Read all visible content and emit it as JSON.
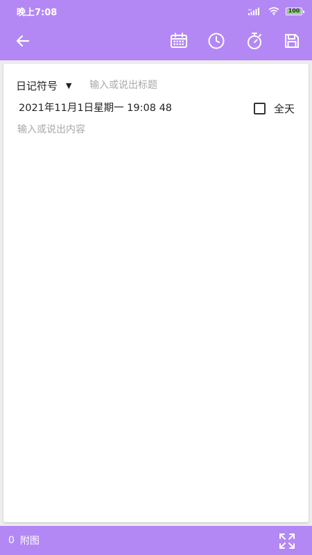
{
  "status_bar": {
    "time": "晚上7:08",
    "battery": "100",
    "battery_color": "#8ee07a"
  },
  "theme": {
    "accent": "#b388f5",
    "background": "#ededed",
    "card": "#ffffff"
  },
  "toolbar": {
    "back_icon": "arrow-left-icon",
    "actions": [
      "calendar-icon",
      "clock-icon",
      "stopwatch-icon",
      "save-icon"
    ]
  },
  "form": {
    "symbol_label": "日记符号",
    "title_placeholder": "输入或说出标题",
    "datetime": "2021年11月1日星期一 19:08 48",
    "allday_label": "全天",
    "allday_checked": false,
    "content_placeholder": "输入或说出内容"
  },
  "bottom_bar": {
    "attachment_count": "0",
    "attachment_label": "附图",
    "fullscreen_icon": "fullscreen-icon"
  }
}
